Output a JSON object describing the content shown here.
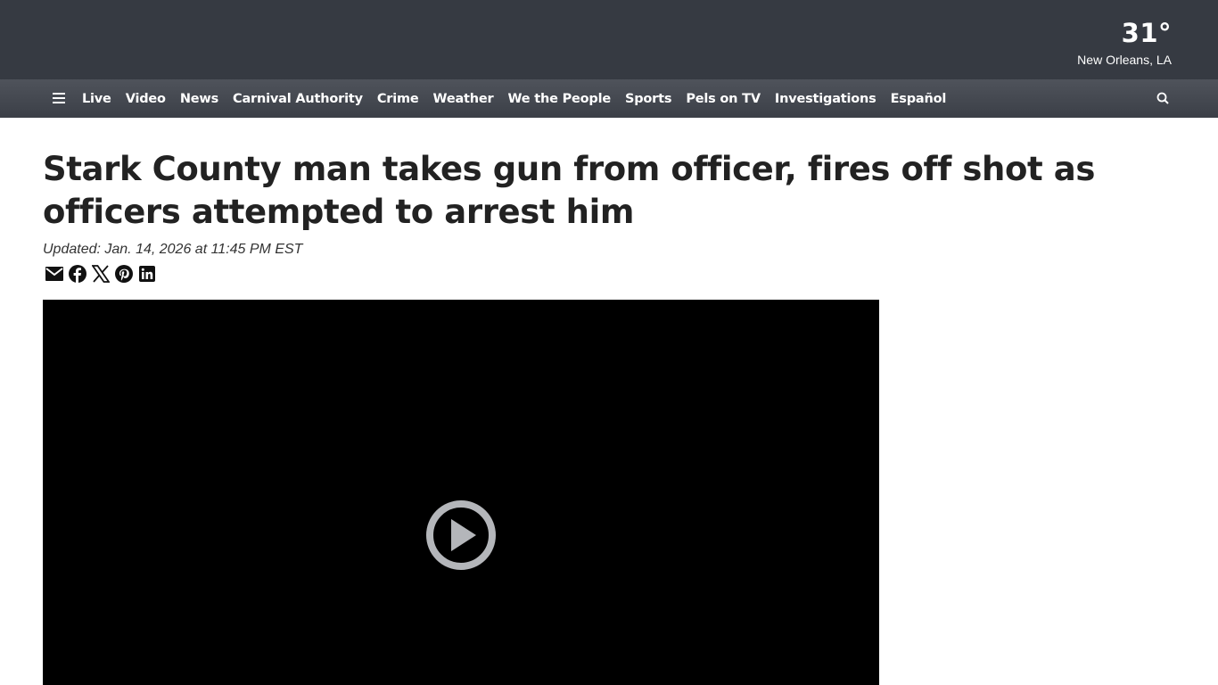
{
  "header": {
    "weather": {
      "temperature": "31°",
      "location": "New Orleans, LA"
    }
  },
  "nav": {
    "menu_icon": "hamburger-menu-icon",
    "search_icon": "search-icon",
    "items": [
      {
        "label": "Live"
      },
      {
        "label": "Video"
      },
      {
        "label": "News"
      },
      {
        "label": "Carnival Authority"
      },
      {
        "label": "Crime"
      },
      {
        "label": "Weather"
      },
      {
        "label": "We the People"
      },
      {
        "label": "Sports"
      },
      {
        "label": "Pels on TV"
      },
      {
        "label": "Investigations"
      },
      {
        "label": "Español"
      }
    ]
  },
  "article": {
    "headline": "Stark County man takes gun from officer, fires off shot as officers attempted to arrest him",
    "updated": "Updated: Jan. 14, 2026 at 11:45 PM EST",
    "share_icons": [
      "email-icon",
      "facebook-icon",
      "x-icon",
      "pinterest-icon",
      "linkedin-icon"
    ]
  },
  "video": {
    "play_icon": "play-icon"
  },
  "colors": {
    "topbar": "#363a42",
    "navbar": "#4a4e56",
    "video_bg": "#000000",
    "play_button": "#b4b6ba"
  }
}
